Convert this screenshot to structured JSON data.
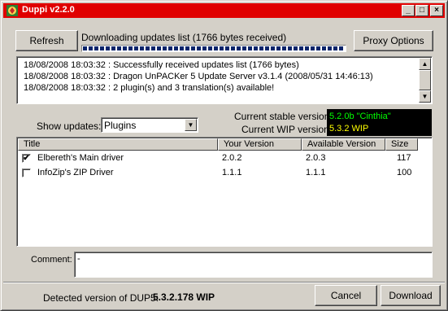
{
  "window": {
    "title": "Duppi v2.2.0",
    "controls": {
      "minimize": "_",
      "maximize": "□",
      "close": "×"
    }
  },
  "toolbar": {
    "refresh_label": "Refresh",
    "status_text": "Downloading updates list (1766 bytes received)",
    "progress": 1.0,
    "proxy_label": "Proxy Options"
  },
  "log": {
    "lines": [
      "18/08/2008 18:03:32 : Successfully received updates list (1766 bytes)",
      "18/08/2008 18:03:32 : Dragon UnPACKer 5 Update Server v3.1.4 (2008/05/31 14:46:13)",
      "18/08/2008 18:03:32 : 2 plugin(s) and 3 translation(s) available!"
    ]
  },
  "filter": {
    "label": "Show updates:",
    "selected": "Plugins"
  },
  "versions": {
    "stable_label": "Current stable version :",
    "stable_value": "5.2.0b \"Cinthia\"",
    "wip_label": "Current WIP version :",
    "wip_value": "5.3.2 WIP",
    "value_color": "#00ff00",
    "wip_color": "#ffff00"
  },
  "table": {
    "columns": [
      "Title",
      "Your Version",
      "Available Version",
      "Size"
    ],
    "rows": [
      {
        "checked": true,
        "title": "Elbereth's Main driver",
        "your_version": "2.0.2",
        "available_version": "2.0.3",
        "size": "117"
      },
      {
        "checked": false,
        "title": "InfoZip's ZIP Driver",
        "your_version": "1.1.1",
        "available_version": "1.1.1",
        "size": "100"
      }
    ]
  },
  "comment": {
    "label": "Comment:",
    "value": "-"
  },
  "footer": {
    "detected_label": "Detected version of DUP5:",
    "detected_value": "5.3.2.178 WIP",
    "cancel_label": "Cancel",
    "download_label": "Download"
  },
  "colors": {
    "titlebar": "#e00000",
    "face": "#d4d0c8",
    "progress": "#0a246a"
  }
}
